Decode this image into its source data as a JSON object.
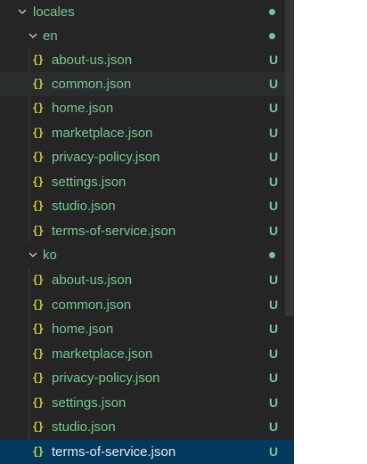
{
  "explorer": {
    "root_folder": {
      "label": "locales",
      "status": "dot",
      "expanded": true
    },
    "folders": [
      {
        "label": "en",
        "status": "dot",
        "expanded": true,
        "files": [
          {
            "label": "about-us.json",
            "status": "U"
          },
          {
            "label": "common.json",
            "status": "U"
          },
          {
            "label": "home.json",
            "status": "U"
          },
          {
            "label": "marketplace.json",
            "status": "U"
          },
          {
            "label": "privacy-policy.json",
            "status": "U"
          },
          {
            "label": "settings.json",
            "status": "U"
          },
          {
            "label": "studio.json",
            "status": "U"
          },
          {
            "label": "terms-of-service.json",
            "status": "U"
          }
        ]
      },
      {
        "label": "ko",
        "status": "dot",
        "expanded": true,
        "files": [
          {
            "label": "about-us.json",
            "status": "U"
          },
          {
            "label": "common.json",
            "status": "U"
          },
          {
            "label": "home.json",
            "status": "U"
          },
          {
            "label": "marketplace.json",
            "status": "U"
          },
          {
            "label": "privacy-policy.json",
            "status": "U"
          },
          {
            "label": "settings.json",
            "status": "U"
          },
          {
            "label": "studio.json",
            "status": "U"
          },
          {
            "label": "terms-of-service.json",
            "status": "U"
          }
        ]
      }
    ],
    "file_icon": "json-braces-icon",
    "file_icon_glyph": "{}",
    "hovered_file": "en/common.json",
    "selected_file": "ko/terms-of-service.json",
    "colors": {
      "background": "#252526",
      "untracked_green": "#73c991",
      "json_icon_yellow": "#cbcb41",
      "selection": "#04395e",
      "hover": "#2a2d2e"
    }
  }
}
